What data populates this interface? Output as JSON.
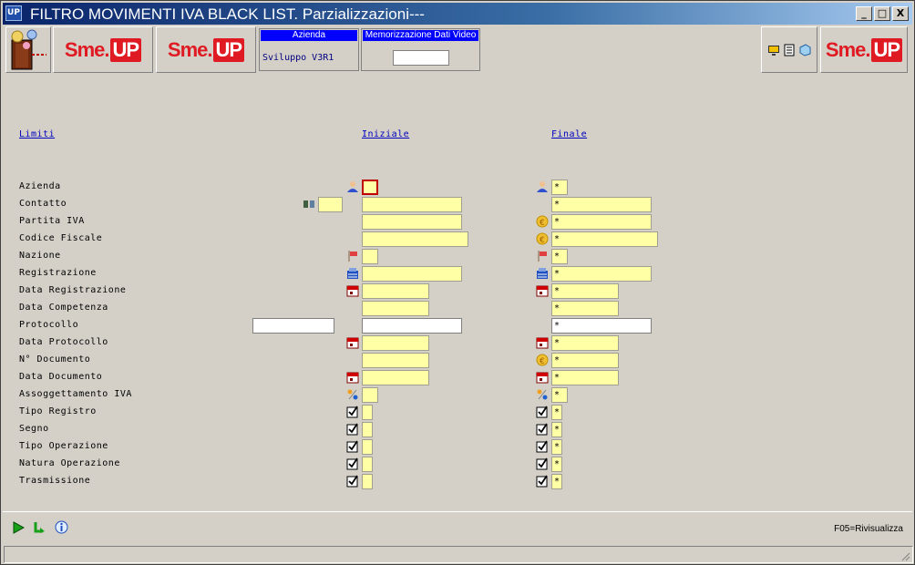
{
  "window": {
    "title": "FILTRO MOVIMENTI IVA BLACK LIST. Parzializzazioni---",
    "app_icon": "UP",
    "min": "_",
    "max": "□",
    "close": "X"
  },
  "toolbar": {
    "logo_prefix": "Sme",
    "logo_dot": ".",
    "logo_suffix": "UP",
    "azienda_label": "Azienda",
    "azienda_value": "Sviluppo V3R1",
    "memo_label": "Memorizzazione Dati Video",
    "memo_value": ""
  },
  "headers": {
    "limiti": "Limiti",
    "iniziale": "Iniziale",
    "finale": "Finale"
  },
  "rows": [
    {
      "label": "Azienda",
      "ini": "",
      "fin": "*"
    },
    {
      "label": "Contatto",
      "pre": "",
      "ini": "",
      "fin": "*"
    },
    {
      "label": "Partita IVA",
      "ini": "",
      "fin": "*"
    },
    {
      "label": "Codice Fiscale",
      "ini": "",
      "fin": "*"
    },
    {
      "label": "Nazione",
      "ini": "",
      "fin": "*"
    },
    {
      "label": "Registrazione",
      "ini": "",
      "fin": "*"
    },
    {
      "label": "Data Registrazione",
      "ini": "",
      "fin": "*"
    },
    {
      "label": "Data Competenza",
      "ini": "",
      "fin": "*"
    },
    {
      "label": "Protocollo",
      "pre": "",
      "ini": "",
      "fin": "*"
    },
    {
      "label": "Data Protocollo",
      "ini": "",
      "fin": "*"
    },
    {
      "label": "N° Documento",
      "ini": "",
      "fin": "*"
    },
    {
      "label": "Data Documento",
      "ini": "",
      "fin": "*"
    },
    {
      "label": "Assoggettamento IVA",
      "ini": "",
      "fin": "*"
    },
    {
      "label": "Tipo Registro",
      "ini": "",
      "fin": "*"
    },
    {
      "label": "Segno",
      "ini": "",
      "fin": "*"
    },
    {
      "label": "Tipo Operazione",
      "ini": "",
      "fin": "*"
    },
    {
      "label": "Natura Operazione",
      "ini": "",
      "fin": "*"
    },
    {
      "label": "Trasmissione",
      "ini": "",
      "fin": "*"
    }
  ],
  "footer": {
    "function_key": "F05=Rivisualizza"
  }
}
